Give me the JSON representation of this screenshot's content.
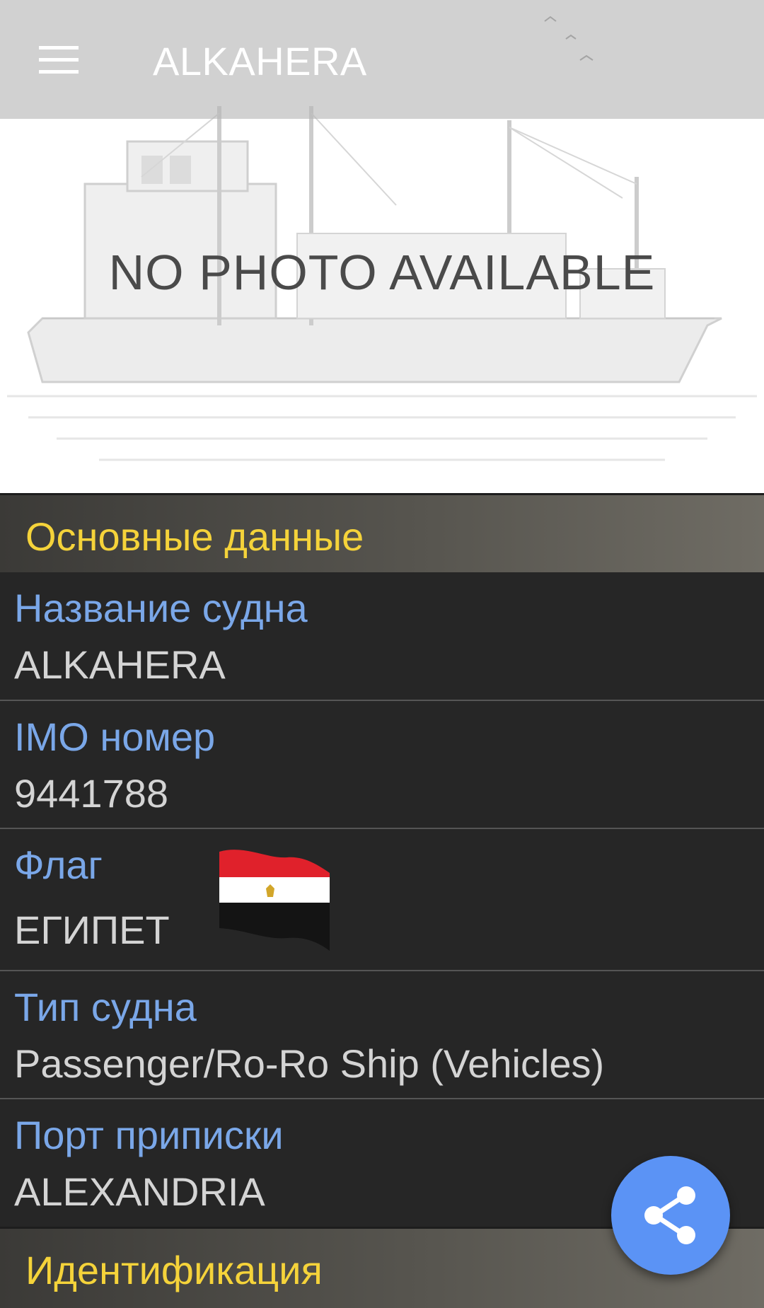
{
  "toolbar": {
    "title": "ALKAHERA",
    "menu_icon": "menu-icon"
  },
  "hero": {
    "placeholder_text": "NO PHOTO AVAILABLE"
  },
  "sections": {
    "main": {
      "title": "Основные данные"
    },
    "identification": {
      "title": "Идентификация"
    }
  },
  "fields": [
    {
      "label": "Название судна",
      "value": "ALKAHERA"
    },
    {
      "label": "IMO номер",
      "value": "9441788"
    },
    {
      "label": "Флаг",
      "value": "ЕГИПЕТ",
      "flag_icon": "egypt-flag-icon"
    },
    {
      "label": "Тип судна",
      "value": "Passenger/Ro-Ro Ship (Vehicles)"
    },
    {
      "label": "Порт приписки",
      "value": "ALEXANDRIA"
    }
  ],
  "fab": {
    "icon": "share-icon",
    "color": "#5b93f5"
  },
  "colors": {
    "label": "#7aa7e8",
    "value": "#d4d4d4",
    "section_title": "#f5d33a",
    "background": "#262626"
  }
}
